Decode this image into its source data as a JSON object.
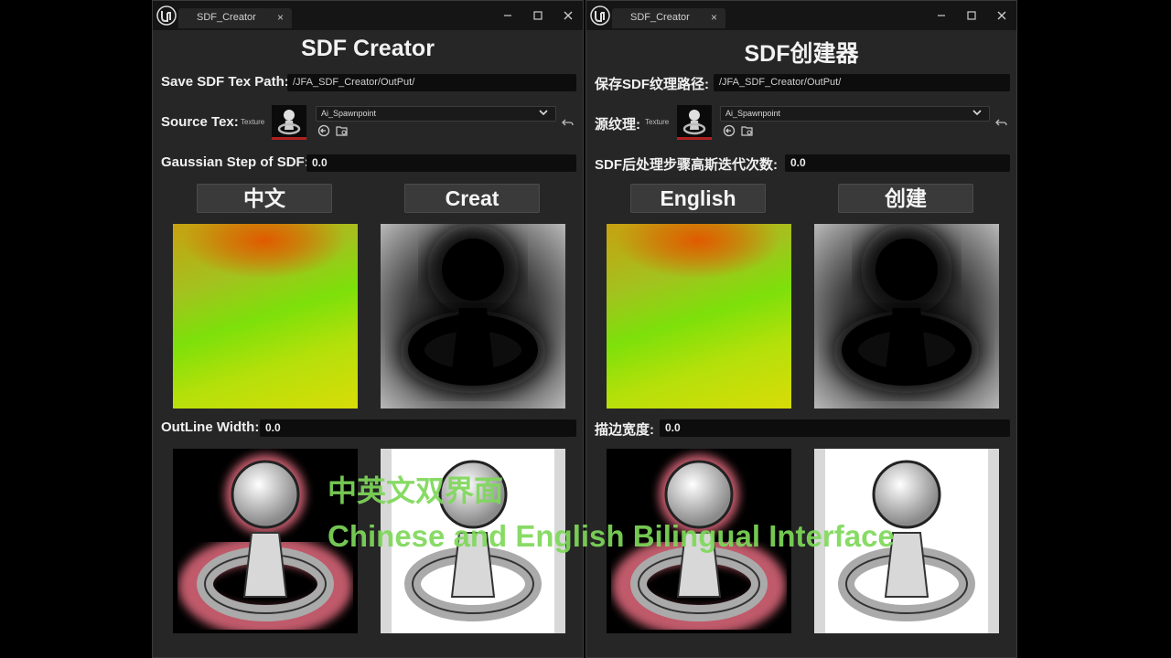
{
  "windows": [
    {
      "tab_title": "SDF_Creator",
      "tab_close": "×",
      "app_title": "SDF Creator",
      "save_path_label": "Save SDF Tex Path:",
      "save_path_value": "/JFA_SDF_Creator/OutPut/",
      "source_tex_label": "Source Tex:",
      "texture_word": "Texture",
      "source_tex_value": "Ai_Spawnpoint",
      "gaussian_label": "Gaussian Step of SDF:",
      "gaussian_value": "0.0",
      "language_button": "中文",
      "create_button": "Creat",
      "outline_label": "OutLine Width:",
      "outline_value": "0.0"
    },
    {
      "tab_title": "SDF_Creator",
      "tab_close": "×",
      "app_title": "SDF创建器",
      "save_path_label": "保存SDF纹理路径:",
      "save_path_value": "/JFA_SDF_Creator/OutPut/",
      "source_tex_label": "源纹理:",
      "texture_word": "Texture",
      "source_tex_value": "Ai_Spawnpoint",
      "gaussian_label": "SDF后处理步骤高斯迭代次数:",
      "gaussian_value": "0.0",
      "language_button": "English",
      "create_button": "创建",
      "outline_label": "描边宽度:",
      "outline_value": "0.0"
    }
  ],
  "overlay": {
    "line1": "中英文双界面",
    "line2": "Chinese and English Bilingual Interface",
    "color": "#7ed85a"
  },
  "colors": {
    "window_bg": "#262626",
    "titlebar_bg": "#151515",
    "field_bg": "#0d0d0d",
    "button_bg": "#3a3a3a",
    "thumb_underline": "#b02020"
  },
  "icons": [
    "unreal-logo-icon",
    "minimize-icon",
    "maximize-icon",
    "close-icon",
    "dropdown-arrow-icon",
    "browse-asset-icon",
    "find-in-browser-icon",
    "reset-arrow-icon"
  ]
}
